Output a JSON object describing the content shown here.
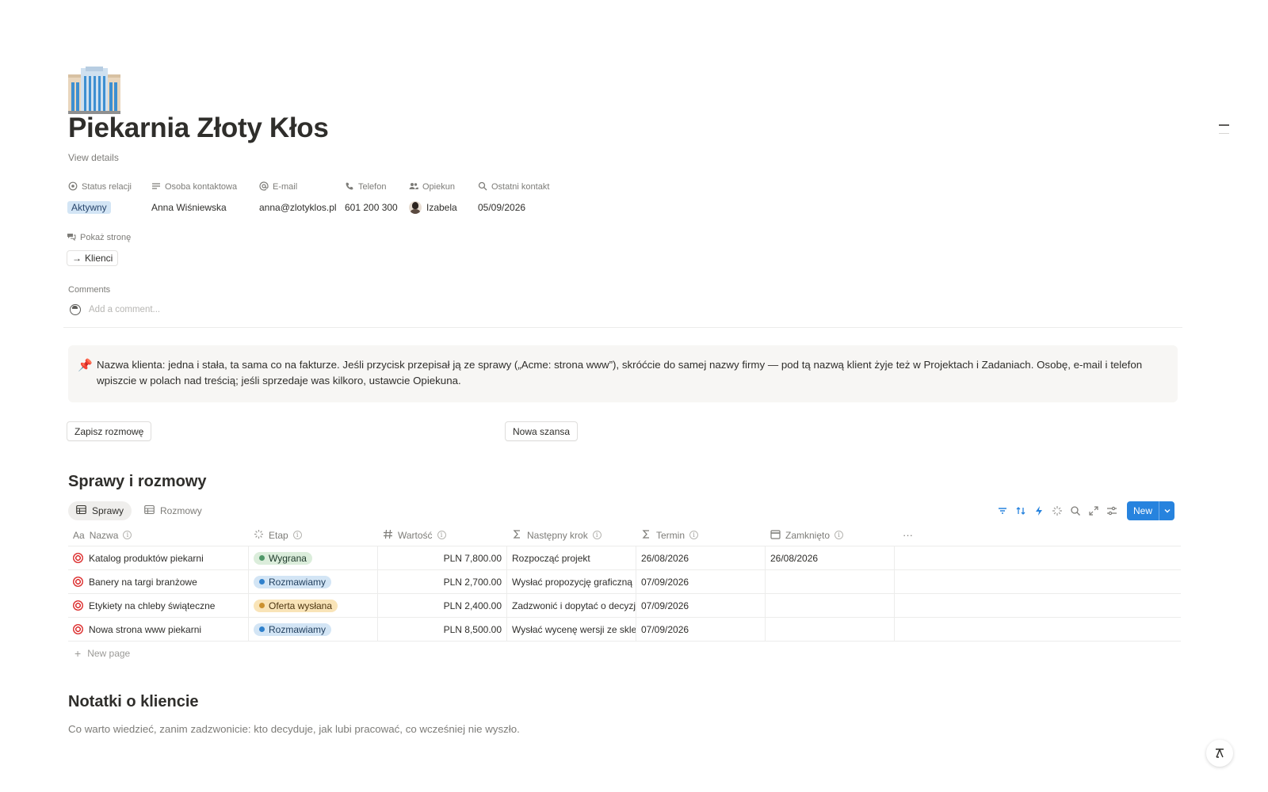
{
  "page": {
    "title": "Piekarnia Złoty Kłos",
    "view_details": "View details",
    "icon": "building-icon"
  },
  "properties": [
    {
      "label": "Status relacji",
      "icon": "status-icon",
      "value": "Aktywny",
      "type": "badge",
      "badge_color": "#d3e5f5"
    },
    {
      "label": "Osoba kontaktowa",
      "icon": "text-lines-icon",
      "value": "Anna Wiśniewska"
    },
    {
      "label": "E-mail",
      "icon": "at-icon",
      "value": "anna@zlotyklos.pl"
    },
    {
      "label": "Telefon",
      "icon": "phone-icon",
      "value": "601 200 300"
    },
    {
      "label": "Opiekun",
      "icon": "people-icon",
      "value": "Izabela"
    },
    {
      "label": "Ostatni kontakt",
      "icon": "search-icon",
      "value": "05/09/2026"
    }
  ],
  "show_page": {
    "label": "Pokaż stronę",
    "icon": "relation-icon",
    "relation": "Klienci",
    "relation_arrow": "→"
  },
  "comments": {
    "label": "Comments",
    "placeholder": "Add a comment..."
  },
  "callout": {
    "icon": "📌",
    "text": "Nazwa klienta: jedna i stała, ta sama co na fakturze. Jeśli przycisk przepisał ją ze sprawy („Acme: strona www”), skróćcie do samej nazwy firmy — pod tą nazwą klient żyje też w Projektach i Zadaniach. Osobę, e-mail i telefon wpiszcie w polach nad treścią; jeśli sprzedaje was kilkoro, ustawcie Opiekuna."
  },
  "buttons": {
    "record_call": "Zapisz rozmowę",
    "new_opportunity": "Nowa szansa"
  },
  "section_cases": {
    "heading": "Sprawy i rozmowy",
    "tabs": [
      "Sprawy",
      "Rozmowy"
    ],
    "active_tab": "Sprawy",
    "new_button": "New",
    "accent": "#2783de",
    "columns": [
      {
        "label": "Nazwa",
        "icon": "title-aa-icon"
      },
      {
        "label": "Etap",
        "icon": "status-spinner-icon"
      },
      {
        "label": "Wartość",
        "icon": "hash-icon"
      },
      {
        "label": "Następny krok",
        "icon": "sigma-icon"
      },
      {
        "label": "Termin",
        "icon": "sigma-icon"
      },
      {
        "label": "Zamknięto",
        "icon": "calendar-icon"
      }
    ],
    "more": "···",
    "rows": [
      {
        "name": "Katalog produktów piekarni",
        "stage": "Wygrana",
        "stage_bg": "#dbeddb",
        "stage_dot": "#4f9768",
        "value": "PLN 7,800.00",
        "next_step": "Rozpocząć projekt",
        "due": "26/08/2026",
        "closed": "26/08/2026"
      },
      {
        "name": "Banery na targi branżowe",
        "stage": "Rozmawiamy",
        "stage_bg": "#d3e5f5",
        "stage_dot": "#2f80cc",
        "value": "PLN 2,700.00",
        "next_step": "Wysłać propozycję graficzną",
        "due": "07/09/2026",
        "closed": ""
      },
      {
        "name": "Etykiety na chleby świąteczne",
        "stage": "Oferta wysłana",
        "stage_bg": "#f9e4b8",
        "stage_dot": "#cb912f",
        "value": "PLN 2,400.00",
        "next_step": "Zadzwonić i dopytać o decyzję",
        "due": "07/09/2026",
        "closed": ""
      },
      {
        "name": "Nowa strona www piekarni",
        "stage": "Rozmawiamy",
        "stage_bg": "#d3e5f5",
        "stage_dot": "#2f80cc",
        "value": "PLN 8,500.00",
        "next_step": "Wysłać wycenę wersji ze sklepem",
        "due": "07/09/2026",
        "closed": ""
      }
    ],
    "new_page": "New page"
  },
  "section_notes": {
    "heading": "Notatki o kliencie",
    "text": "Co warto wiedzieć, zanim zadzwonicie: kto decyduje, jak lubi pracować, co wcześniej nie wyszło."
  }
}
